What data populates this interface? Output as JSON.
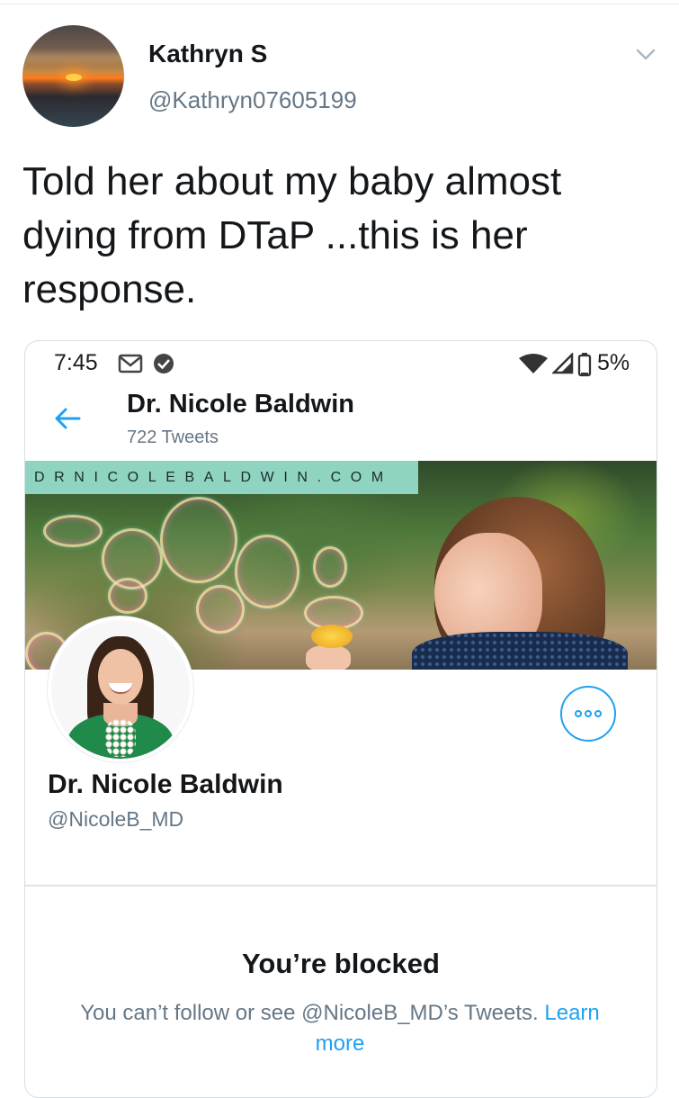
{
  "tweet": {
    "display_name": "Kathryn S",
    "handle": "@Kathryn07605199",
    "text": "Told her about my baby almost dying from DTaP ...this is her response."
  },
  "screenshot": {
    "status_bar": {
      "time": "7:45",
      "battery": "5%",
      "icons": [
        "gmail-icon",
        "check-circle-icon",
        "wifi-icon",
        "signal-icon",
        "battery-icon"
      ]
    },
    "header": {
      "name": "Dr. Nicole Baldwin",
      "tweet_count": "722 Tweets"
    },
    "banner": {
      "tag": "DRNICOLEBALDWIN.COM"
    },
    "profile": {
      "name": "Dr. Nicole Baldwin",
      "handle": "@NicoleB_MD"
    },
    "blocked": {
      "title": "You’re blocked",
      "text": "You can’t follow or see @NicoleB_MD’s Tweets.",
      "link": "Learn more"
    }
  },
  "colors": {
    "accent": "#1da1f2",
    "secondary_text": "#657786",
    "banner_tag": "#8fd4c1"
  }
}
